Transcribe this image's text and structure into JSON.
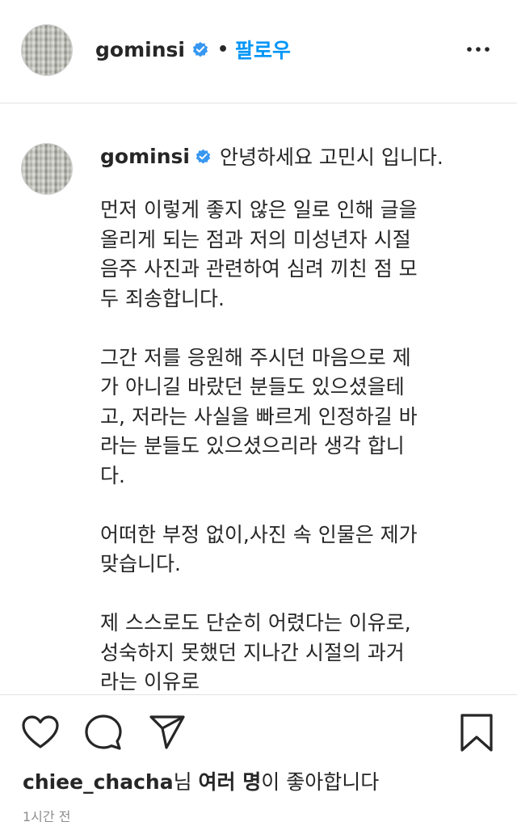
{
  "header": {
    "username": "gominsi",
    "follow_label": "팔로우",
    "dot": "•"
  },
  "caption": {
    "username": "gominsi",
    "first_line": "안녕하세요 고민시 입니다.",
    "paragraphs": [
      "먼저 이렇게 좋지 않은 일로 인해 글을\n올리게 되는 점과 저의 미성년자 시절\n음주 사진과 관련하여 심려 끼친 점 모\n두 죄송합니다.",
      "그간 저를 응원해 주시던 마음으로 제\n가 아니길 바랐던 분들도 있으셨을테\n고, 저라는 사실을 빠르게 인정하길 바\n라는 분들도 있으셨으리라 생각 합니\n다.",
      "어떠한 부정 없이,사진 속 인물은 제가\n맞습니다.",
      "제 스스로도 단순히 어렸다는 이유로,\n성숙하지 못했던 지나간 시절의 과거\n라는 이유로\n모든 것이 묻혀지고 씻겨지는 것은 분"
    ]
  },
  "likes": {
    "user": "chiee_chacha",
    "suffix_1": "님 ",
    "others": "여러 명",
    "suffix_2": "이 좋아합니다"
  },
  "timestamp": "1시간 전",
  "icons": {
    "verified": "verified-badge-icon",
    "more": "more-options-icon",
    "like": "heart-icon",
    "comment": "comment-icon",
    "share": "share-icon",
    "save": "bookmark-icon"
  },
  "colors": {
    "accent": "#0095f6",
    "text": "#262626",
    "muted": "#8e8e8e"
  }
}
